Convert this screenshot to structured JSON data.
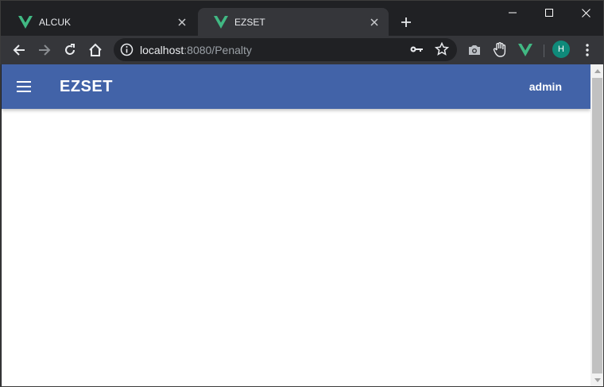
{
  "browser": {
    "tabs": [
      {
        "title": "ALCUK",
        "icon": "vue-logo-icon",
        "active": false
      },
      {
        "title": "EZSET",
        "icon": "vue-logo-icon",
        "active": true
      }
    ],
    "url": {
      "host": "localhost",
      "rest": ":8080/Penalty"
    },
    "profile_initial": "H",
    "colors": {
      "frame": "#202124",
      "toolbar": "#35363a",
      "vue_green": "#41b883",
      "avatar": "#0f8a7a"
    }
  },
  "app": {
    "title": "EZSET",
    "user": "admin",
    "colors": {
      "appbar": "#4263a8",
      "text": "#ffffff"
    }
  }
}
